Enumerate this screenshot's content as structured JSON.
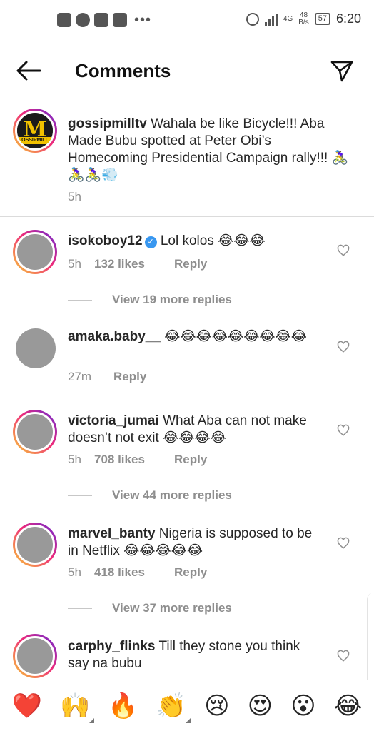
{
  "status_bar": {
    "net_speed_value": "48",
    "net_speed_unit": "B/s",
    "network_type": "4G",
    "battery": "57",
    "time": "6:20"
  },
  "header": {
    "title": "Comments"
  },
  "caption": {
    "username": "gossipmilltv",
    "text": "Wahala be like Bicycle!!! Aba Made Bubu spotted at Peter Obi’s Homecoming Presidential Campaign rally!!! 🚴‍♀️🚴‍♀️🚴‍♀️💨",
    "time": "5h"
  },
  "comments": [
    {
      "username": "isokoboy12",
      "verified": true,
      "text": "Lol kolos 😂😂😂",
      "time": "5h",
      "likes": "132 likes",
      "reply": "Reply",
      "view_replies": "View 19 more replies"
    },
    {
      "username": "amaka.baby__",
      "verified": false,
      "text": "😂😂😂😂😂😂😂😂😂",
      "time": "27m",
      "likes": "",
      "reply": "Reply",
      "view_replies": ""
    },
    {
      "username": "victoria_jumai",
      "verified": false,
      "text": "What Aba can not make doesn’t not exit 😂😂😂😂",
      "time": "5h",
      "likes": "708 likes",
      "reply": "Reply",
      "view_replies": "View 44 more replies"
    },
    {
      "username": "marvel_banty",
      "verified": false,
      "text": "Nigeria is supposed to be in Netflix 😂😂😂😂😂",
      "time": "5h",
      "likes": "418 likes",
      "reply": "Reply",
      "view_replies": "View 37 more replies"
    },
    {
      "username": "carphy_flinks",
      "verified": false,
      "text": "Till they stone you think say na bubu",
      "time": "",
      "likes": "",
      "reply": "",
      "view_replies": ""
    }
  ],
  "emoji_bar": [
    "❤️",
    "🙌",
    "🔥",
    "👏",
    "😢",
    "😍",
    "😮",
    "😂"
  ],
  "icons": {
    "back": "arrow-left-icon",
    "send": "paper-plane-icon",
    "like": "heart-outline-icon"
  },
  "colors": {
    "story_ring_start": "#f9ce34",
    "story_ring_mid": "#ee2a7b",
    "story_ring_end": "#6228d7",
    "verified_blue": "#3897f0",
    "secondary_text": "#8e8e8e"
  }
}
